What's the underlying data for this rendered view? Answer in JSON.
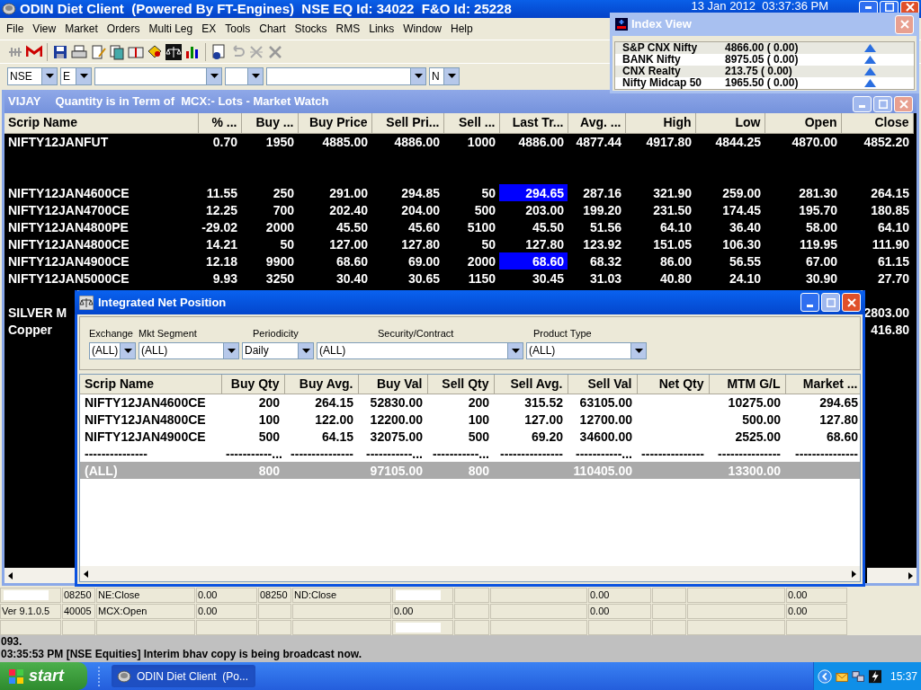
{
  "app": {
    "title": "ODIN Diet Client  (Powered By FT-Engines)  NSE EQ Id: 34022  F&O Id: 25228",
    "datetime": "13 Jan 2012  03:37:36 PM"
  },
  "menu": [
    "File",
    "View",
    "Market",
    "Orders",
    "Multi Leg",
    "EX",
    "Tools",
    "Chart",
    "Stocks",
    "RMS",
    "Links",
    "Window",
    "Help"
  ],
  "selectors": [
    {
      "kind": "filled",
      "value": "NSE"
    },
    {
      "kind": "filled",
      "value": "E"
    },
    {
      "kind": "empty"
    },
    {
      "kind": "empty"
    },
    {
      "kind": "empty"
    },
    {
      "kind": "filled",
      "value": "N"
    }
  ],
  "market_watch": {
    "title": "VIJAY",
    "subtitle": "Quantity is in Term of  MCX:- Lots - Market Watch",
    "columns": [
      "Scrip Name",
      "% ...",
      "Buy ...",
      "Buy Price",
      "Sell Pri...",
      "Sell ...",
      "Last Tr...",
      "Avg. ...",
      "High",
      "Low",
      "Open",
      "Close"
    ],
    "rows": [
      {
        "kind": "scrip",
        "flash": false,
        "cells": [
          "NIFTY12JANFUT",
          "0.70",
          "1950",
          "4885.00",
          "4886.00",
          "1000",
          "4886.00",
          "4877.44",
          "4917.80",
          "4844.25",
          "4870.00",
          "4852.20"
        ]
      },
      {
        "kind": "blank"
      },
      {
        "kind": "blank"
      },
      {
        "kind": "scrip",
        "flash": true,
        "cells": [
          "NIFTY12JAN4600CE",
          "11.55",
          "250",
          "291.00",
          "294.85",
          "50",
          "294.65",
          "287.16",
          "321.90",
          "259.00",
          "281.30",
          "264.15"
        ]
      },
      {
        "kind": "scrip",
        "flash": false,
        "cells": [
          "NIFTY12JAN4700CE",
          "12.25",
          "700",
          "202.40",
          "204.00",
          "500",
          "203.00",
          "199.20",
          "231.50",
          "174.45",
          "195.70",
          "180.85"
        ]
      },
      {
        "kind": "scrip",
        "flash": false,
        "cells": [
          "NIFTY12JAN4800PE",
          "-29.02",
          "2000",
          "45.50",
          "45.60",
          "5100",
          "45.50",
          "51.56",
          "64.10",
          "36.40",
          "58.00",
          "64.10"
        ]
      },
      {
        "kind": "scrip",
        "flash": false,
        "cells": [
          "NIFTY12JAN4800CE",
          "14.21",
          "50",
          "127.00",
          "127.80",
          "50",
          "127.80",
          "123.92",
          "151.05",
          "106.30",
          "119.95",
          "111.90"
        ]
      },
      {
        "kind": "scrip",
        "flash": true,
        "cells": [
          "NIFTY12JAN4900CE",
          "12.18",
          "9900",
          "68.60",
          "69.00",
          "2000",
          "68.60",
          "68.32",
          "86.00",
          "56.55",
          "67.00",
          "61.15"
        ]
      },
      {
        "kind": "scrip",
        "flash": false,
        "cells": [
          "NIFTY12JAN5000CE",
          "9.93",
          "3250",
          "30.40",
          "30.65",
          "1150",
          "30.45",
          "31.03",
          "40.80",
          "24.10",
          "30.90",
          "27.70"
        ]
      },
      {
        "kind": "blank"
      },
      {
        "kind": "partial",
        "scrip": "SILVER M",
        "close": "2803.00"
      },
      {
        "kind": "partial",
        "scrip": "Copper",
        "close": "416.80"
      }
    ]
  },
  "net_position": {
    "title": "Integrated Net Position",
    "filters": [
      {
        "label": "Exchange",
        "value": "(ALL)"
      },
      {
        "label": "Mkt Segment",
        "value": "(ALL)"
      },
      {
        "label": "Periodicity",
        "value": "Daily"
      },
      {
        "label": "Security/Contract",
        "value": "(ALL)"
      },
      {
        "label": "Product Type",
        "value": "(ALL)"
      }
    ],
    "columns": [
      "Scrip Name",
      "Buy Qty",
      "Buy Avg.",
      "Buy Val",
      "Sell Qty",
      "Sell Avg.",
      "Sell Val",
      "Net Qty",
      "MTM G/L",
      "Market ..."
    ],
    "rows": [
      {
        "kind": "position",
        "cells": [
          {
            "kind": "value",
            "text": "NIFTY12JAN4600CE"
          },
          {
            "kind": "value",
            "text": "200"
          },
          {
            "kind": "value",
            "text": "264.15"
          },
          {
            "kind": "value",
            "text": "52830.00"
          },
          {
            "kind": "value",
            "text": "200"
          },
          {
            "kind": "value",
            "text": "315.52"
          },
          {
            "kind": "value",
            "text": "63105.00"
          },
          {
            "kind": "empty"
          },
          {
            "kind": "value",
            "text": "10275.00"
          },
          {
            "kind": "value",
            "text": "294.65"
          }
        ]
      },
      {
        "kind": "position",
        "cells": [
          {
            "kind": "value",
            "text": "NIFTY12JAN4800CE"
          },
          {
            "kind": "value",
            "text": "100"
          },
          {
            "kind": "value",
            "text": "122.00"
          },
          {
            "kind": "value",
            "text": "12200.00"
          },
          {
            "kind": "value",
            "text": "100"
          },
          {
            "kind": "value",
            "text": "127.00"
          },
          {
            "kind": "value",
            "text": "12700.00"
          },
          {
            "kind": "empty"
          },
          {
            "kind": "value",
            "text": "500.00"
          },
          {
            "kind": "value",
            "text": "127.80"
          }
        ]
      },
      {
        "kind": "position",
        "cells": [
          {
            "kind": "value",
            "text": "NIFTY12JAN4900CE"
          },
          {
            "kind": "value",
            "text": "500"
          },
          {
            "kind": "value",
            "text": "64.15"
          },
          {
            "kind": "value",
            "text": "32075.00"
          },
          {
            "kind": "value",
            "text": "500"
          },
          {
            "kind": "value",
            "text": "69.20"
          },
          {
            "kind": "value",
            "text": "34600.00"
          },
          {
            "kind": "empty"
          },
          {
            "kind": "value",
            "text": "2525.00"
          },
          {
            "kind": "value",
            "text": "68.60"
          }
        ]
      },
      {
        "kind": "separator",
        "cells": [
          {
            "kind": "value",
            "text": "---------------"
          },
          {
            "kind": "value",
            "text": "-----------..."
          },
          {
            "kind": "value",
            "text": "---------------"
          },
          {
            "kind": "value",
            "text": "-----------..."
          },
          {
            "kind": "value",
            "text": "-----------..."
          },
          {
            "kind": "value",
            "text": "---------------"
          },
          {
            "kind": "value",
            "text": "-----------..."
          },
          {
            "kind": "value",
            "text": "---------------"
          },
          {
            "kind": "value",
            "text": "---------------"
          },
          {
            "kind": "value",
            "text": "---------------"
          }
        ]
      },
      {
        "kind": "total",
        "cells": [
          {
            "kind": "value",
            "text": "(ALL)"
          },
          {
            "kind": "value",
            "text": "800"
          },
          {
            "kind": "empty"
          },
          {
            "kind": "value",
            "text": "97105.00"
          },
          {
            "kind": "value",
            "text": "800"
          },
          {
            "kind": "empty"
          },
          {
            "kind": "value",
            "text": "110405.00"
          },
          {
            "kind": "empty"
          },
          {
            "kind": "value",
            "text": "13300.00"
          },
          {
            "kind": "empty"
          }
        ]
      }
    ]
  },
  "index_view": {
    "title": "Index View",
    "rows": [
      {
        "name": "S&P CNX Nifty",
        "value": "4866.00 ( 0.00)"
      },
      {
        "name": "BANK Nifty",
        "value": "8975.05 ( 0.00)"
      },
      {
        "name": "CNX Realty",
        "value": "213.75 ( 0.00)"
      },
      {
        "name": "Nifty Midcap 50",
        "value": "1965.50 ( 0.00)"
      }
    ]
  },
  "status_grid": [
    [
      {
        "kind": "masked"
      },
      {
        "kind": "text",
        "text": "08250"
      },
      {
        "kind": "text",
        "text": "NE:Close"
      },
      {
        "kind": "text",
        "text": "0.00"
      },
      {
        "kind": "text",
        "text": "08250"
      },
      {
        "kind": "text",
        "text": "ND:Close"
      },
      {
        "kind": "masked"
      },
      {
        "kind": "empty"
      },
      {
        "kind": "empty"
      },
      {
        "kind": "text",
        "text": "0.00"
      },
      {
        "kind": "empty"
      },
      {
        "kind": "empty"
      },
      {
        "kind": "text",
        "text": "0.00"
      }
    ],
    [
      {
        "kind": "text",
        "text": "Ver 9.1.0.5"
      },
      {
        "kind": "text",
        "text": "40005"
      },
      {
        "kind": "text",
        "text": "MCX:Open"
      },
      {
        "kind": "text",
        "text": "0.00"
      },
      {
        "kind": "empty"
      },
      {
        "kind": "empty"
      },
      {
        "kind": "text",
        "text": "0.00"
      },
      {
        "kind": "empty"
      },
      {
        "kind": "empty"
      },
      {
        "kind": "text",
        "text": "0.00"
      },
      {
        "kind": "empty"
      },
      {
        "kind": "empty"
      },
      {
        "kind": "text",
        "text": "0.00"
      }
    ],
    [
      {
        "kind": "empty"
      },
      {
        "kind": "empty"
      },
      {
        "kind": "empty"
      },
      {
        "kind": "empty"
      },
      {
        "kind": "empty"
      },
      {
        "kind": "empty"
      },
      {
        "kind": "masked"
      },
      {
        "kind": "empty"
      },
      {
        "kind": "empty"
      },
      {
        "kind": "empty"
      },
      {
        "kind": "empty"
      },
      {
        "kind": "empty"
      },
      {
        "kind": "empty"
      }
    ]
  ],
  "messages": [
    "093.",
    "03:35:53 PM [NSE Equities] Interim bhav copy is being broadcast now."
  ],
  "taskbar": {
    "start": "start",
    "tasks": [
      {
        "label": "ODIN Diet Client  (Po...",
        "selected": true
      }
    ],
    "clock": "15:37"
  }
}
